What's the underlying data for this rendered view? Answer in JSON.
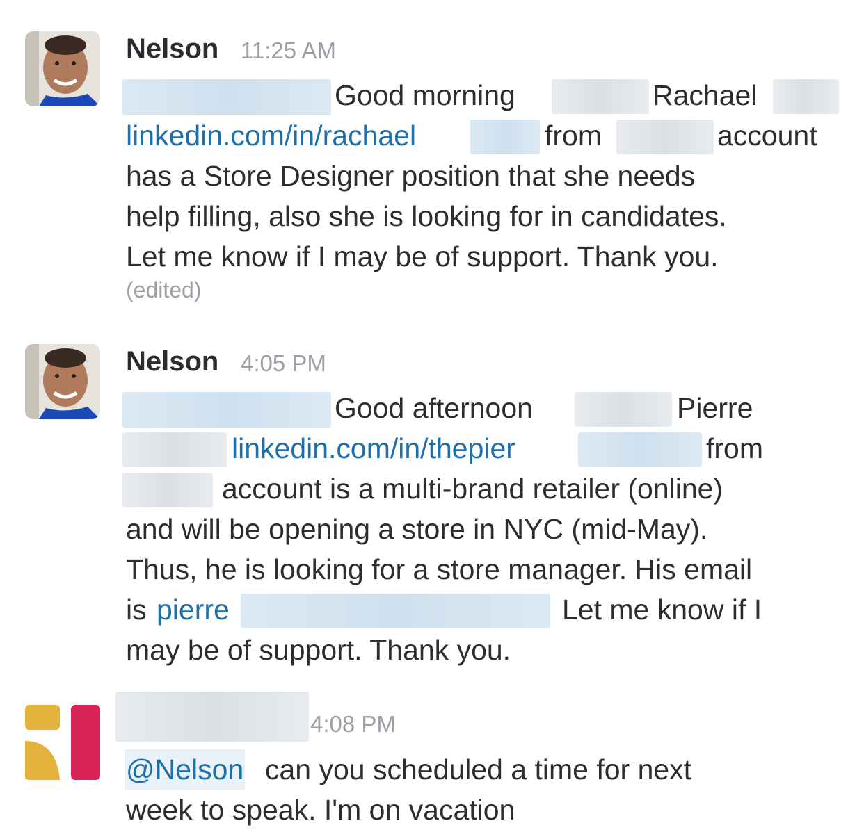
{
  "messages": [
    {
      "author": "Nelson",
      "time": "11:25 AM",
      "greeting": "Good morning",
      "first_name": "Rachael",
      "link": "linkedin.com/in/rachael",
      "from": "from",
      "account": "account",
      "line3": "has a Store Designer position that she needs",
      "line4": "help filling, also she is looking for in candidates.",
      "line5": "Let me know if I may be of support. Thank you.",
      "edited": "(edited)"
    },
    {
      "author": "Nelson",
      "time": "4:05 PM",
      "greeting": "Good afternoon",
      "first_name": "Pierre",
      "link": "linkedin.com/in/thepier",
      "from": "from",
      "line3": "account is a multi-brand retailer (online)",
      "line4": "and will be opening a store in NYC (mid-May).",
      "line5": "Thus, he is looking for a store manager. His email",
      "is": "is",
      "email": "pierre",
      "line6_tail": "Let me know if I",
      "line7": "may be of support. Thank you."
    },
    {
      "time": "4:08 PM",
      "mention": "@Nelson",
      "line1_rest": "can you scheduled a time for next",
      "line2": "week to speak.  I'm on vacation"
    }
  ],
  "colors": {
    "link": "#1f6fa8",
    "muted": "#9e9ea6",
    "logo_yellow": "#e3b23c",
    "logo_red": "#d9245a"
  }
}
